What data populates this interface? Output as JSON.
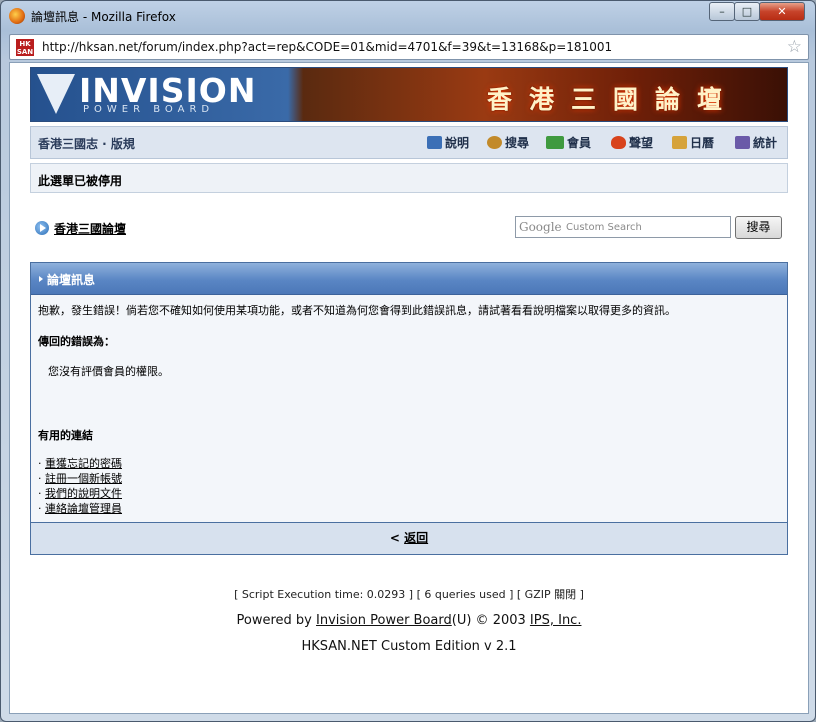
{
  "window": {
    "title": "論壇訊息 - Mozilla Firefox",
    "minimize": "–",
    "maximize": "□",
    "close": "✕"
  },
  "urlbar": {
    "favicon": "HK SAN",
    "url": "http://hksan.net/forum/index.php?act=rep&CODE=01&mid=4701&f=39&t=13168&p=181001"
  },
  "banner": {
    "logo_main": "INVISION",
    "logo_sub": "POWER BOARD",
    "cn_title": "香港三國論壇"
  },
  "nav": {
    "breadcrumb": "香港三國志 · 版規",
    "items": [
      {
        "label": "說明",
        "icon": "help-icon",
        "color": "#3b6fb6"
      },
      {
        "label": "搜尋",
        "icon": "search-icon",
        "color": "#c28a2a"
      },
      {
        "label": "會員",
        "icon": "members-icon",
        "color": "#3f9a3f"
      },
      {
        "label": "聲望",
        "icon": "heart-icon",
        "color": "#d8431c"
      },
      {
        "label": "日曆",
        "icon": "calendar-icon",
        "color": "#d6a33b"
      },
      {
        "label": "統計",
        "icon": "stats-icon",
        "color": "#6a5aa8"
      }
    ]
  },
  "notice": "此選單已被停用",
  "crumb": {
    "link": "香港三國論壇"
  },
  "search": {
    "brand": "Google",
    "placeholder": "Custom Search",
    "button": "搜尋"
  },
  "panel": {
    "title": "論壇訊息",
    "intro": "抱歉，發生錯誤！倘若您不確知如何使用某項功能，或者不知道為何您會得到此錯誤訊息，請試著看看說明檔案以取得更多的資訊。",
    "error_label": "傳回的錯誤為：",
    "error_message": "您沒有評價會員的權限。",
    "links_heading": "有用的連結",
    "links": [
      "重獲忘記的密碼",
      "註冊一個新帳號",
      "我們的說明文件",
      "連絡論壇管理員"
    ],
    "back_prefix": "<",
    "back": "返回"
  },
  "footer": {
    "stats": "[ Script Execution time: 0.0293 ]  [ 6 queries used ]  [ GZIP 關閉 ]",
    "powered_prefix": "Powered by",
    "powered_link": "Invision Power Board",
    "powered_mid": "(U) © 2003",
    "ips_link": "IPS, Inc.",
    "edition": "HKSAN.NET Custom Edition v 2.1"
  },
  "colors": {
    "accent": "#4c78b8",
    "nav_bg": "#dde5f0"
  }
}
